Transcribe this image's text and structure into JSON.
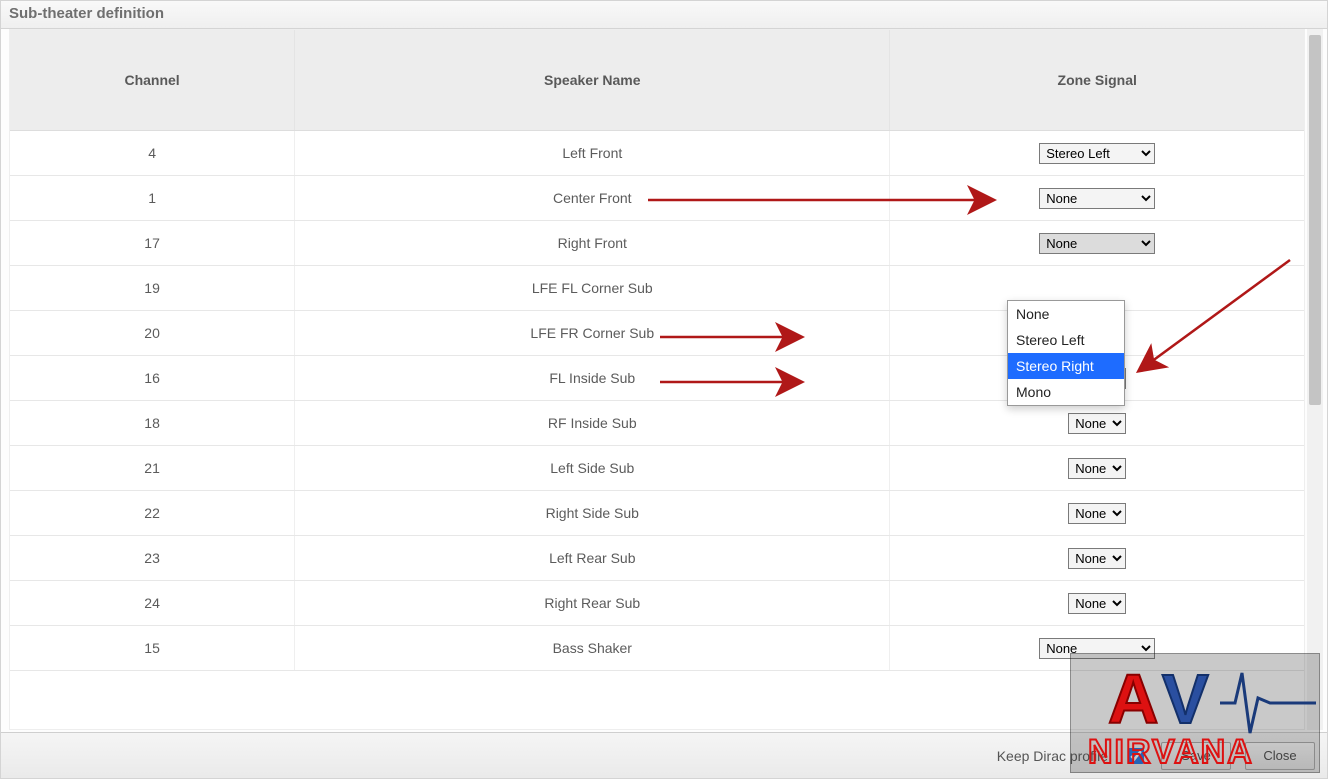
{
  "dialogTitle": "Sub-theater definition",
  "columns": {
    "c1": "Channel",
    "c2": "Speaker Name",
    "c3": "Zone Signal"
  },
  "rows": [
    {
      "ch": "4",
      "name": "Left Front",
      "zone": "Stereo Left",
      "wide": true
    },
    {
      "ch": "1",
      "name": "Center Front",
      "zone": "None",
      "wide": true
    },
    {
      "ch": "17",
      "name": "Right Front",
      "zone": "None",
      "wide": true,
      "active": true
    },
    {
      "ch": "19",
      "name": "LFE FL Corner Sub",
      "zone": "",
      "hidden": true
    },
    {
      "ch": "20",
      "name": "LFE FR Corner Sub",
      "zone": "",
      "hidden": true
    },
    {
      "ch": "16",
      "name": "FL Inside Sub",
      "zone": "None"
    },
    {
      "ch": "18",
      "name": "RF Inside Sub",
      "zone": "None"
    },
    {
      "ch": "21",
      "name": "Left Side Sub",
      "zone": "None"
    },
    {
      "ch": "22",
      "name": "Right Side Sub",
      "zone": "None"
    },
    {
      "ch": "23",
      "name": "Left Rear Sub",
      "zone": "None"
    },
    {
      "ch": "24",
      "name": "Right Rear Sub",
      "zone": "None"
    },
    {
      "ch": "15",
      "name": "Bass Shaker",
      "zone": "None",
      "wide": true
    }
  ],
  "dropdownOptions": [
    {
      "label": "None"
    },
    {
      "label": "Stereo Left"
    },
    {
      "label": "Stereo Right",
      "highlight": true
    },
    {
      "label": "Mono"
    }
  ],
  "footer": {
    "keepLabel": "Keep Dirac profile",
    "saveLabel": "Save",
    "closeLabel": "Close"
  },
  "watermark": {
    "top": "AV",
    "bottom": "NIRVANA"
  }
}
